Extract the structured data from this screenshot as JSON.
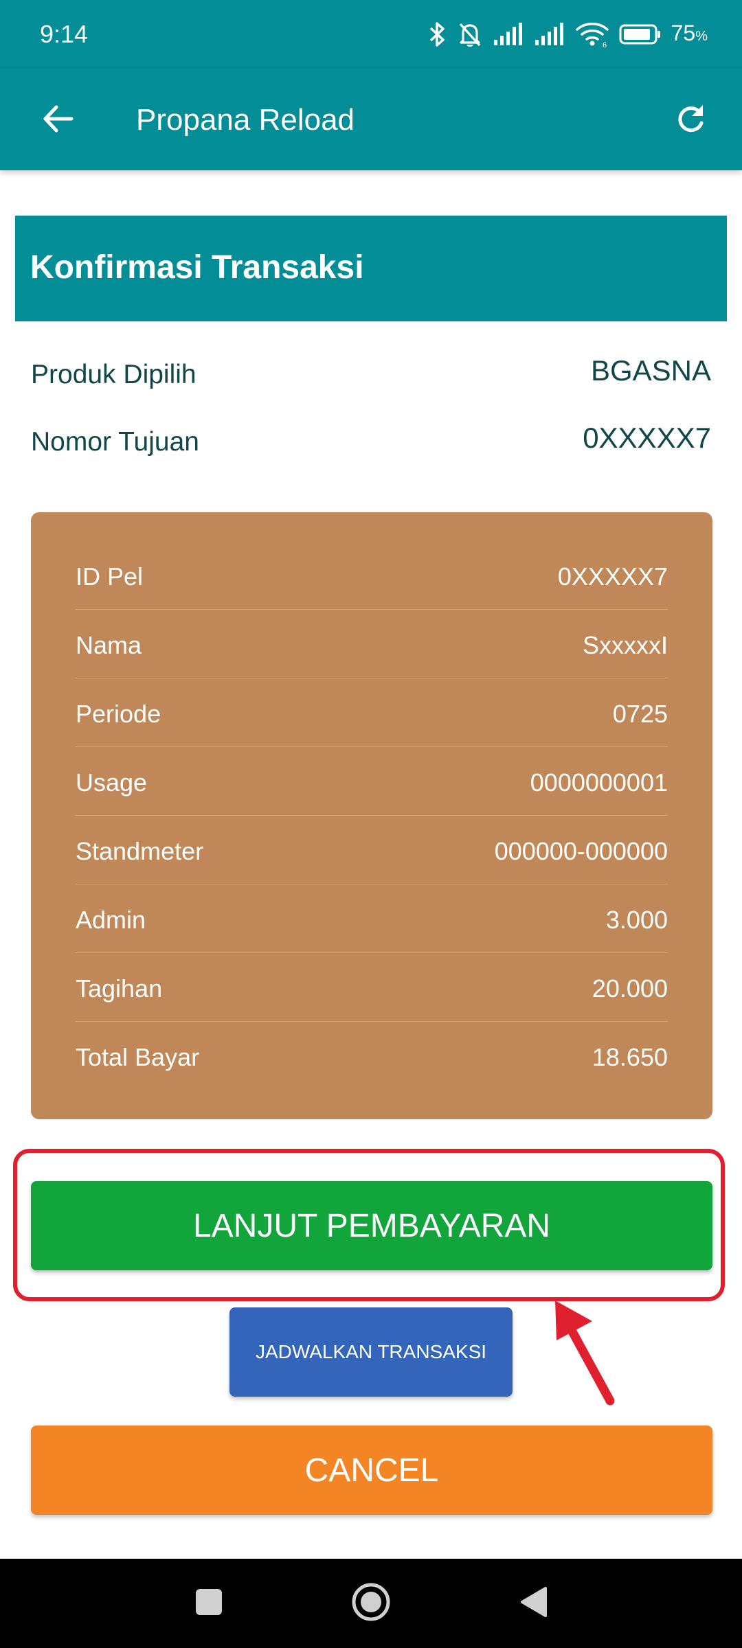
{
  "status_bar": {
    "time": "9:14",
    "battery_percent": "75",
    "battery_suffix": "%",
    "icons": [
      "bluetooth-icon",
      "bell-muted-icon",
      "signal-icon",
      "signal-icon",
      "wifi-icon",
      "battery-icon"
    ]
  },
  "app_bar": {
    "title": "Propana Reload",
    "back_icon": "arrow-left-icon",
    "refresh_icon": "refresh-icon"
  },
  "confirmation": {
    "title": "Konfirmasi Transaksi",
    "summary": [
      {
        "label": "Produk Dipilih",
        "value": "BGASNA"
      },
      {
        "label": "Nomor Tujuan",
        "value": "0XXXXX7"
      }
    ],
    "details": [
      {
        "label": "ID Pel",
        "value": "0XXXXX7"
      },
      {
        "label": "Nama",
        "value": "SxxxxxI"
      },
      {
        "label": "Periode",
        "value": "0725"
      },
      {
        "label": "Usage",
        "value": "0000000001"
      },
      {
        "label": "Standmeter",
        "value": "000000-000000"
      },
      {
        "label": "Admin",
        "value": "3.000"
      },
      {
        "label": "Tagihan",
        "value": "20.000"
      },
      {
        "label": "Total Bayar",
        "value": "18.650"
      }
    ]
  },
  "buttons": {
    "pay_label": "LANJUT PEMBAYARAN",
    "schedule_label": "JADWALKAN TRANSAKSI",
    "cancel_label": "CANCEL"
  },
  "colors": {
    "primary": "#038d96",
    "card": "#c08858",
    "pay": "#11a53c",
    "schedule": "#3366bb",
    "cancel": "#f38524",
    "annotation": "#e0202f"
  },
  "nav_bar": {
    "icons": [
      "square-icon",
      "circle-icon",
      "triangle-back-icon"
    ]
  }
}
